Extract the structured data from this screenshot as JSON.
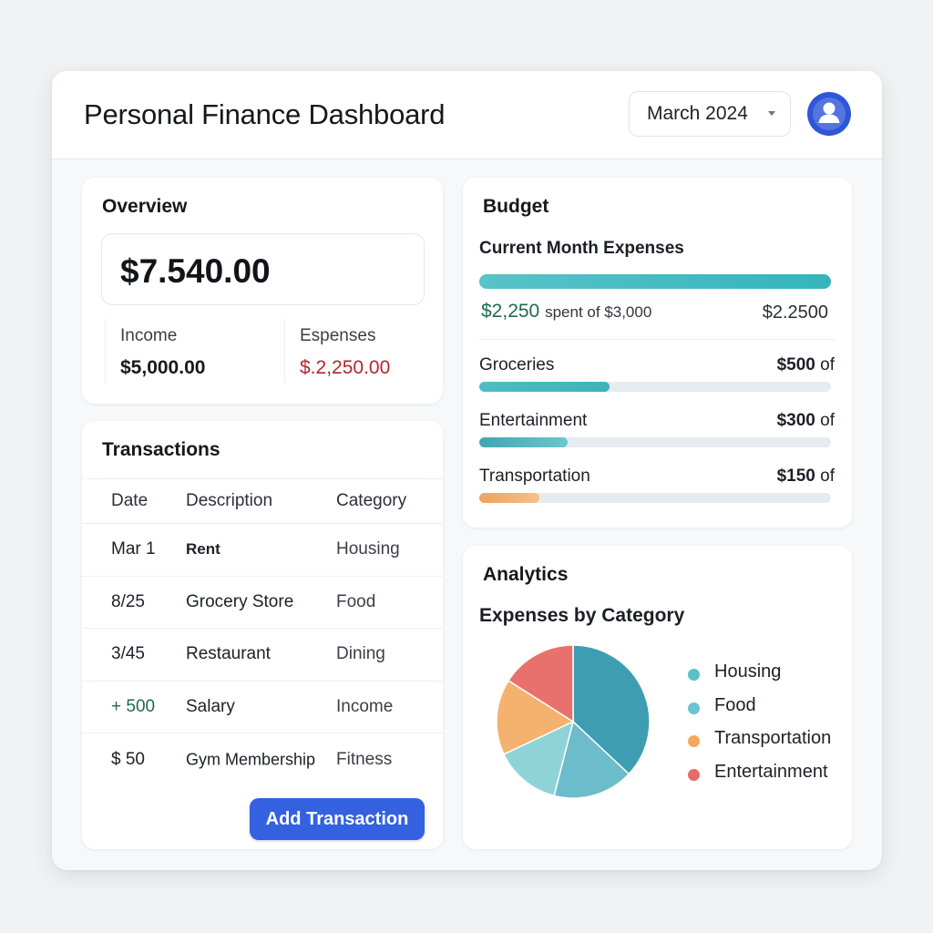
{
  "header": {
    "title": "Personal Finance Dashboard",
    "month_selector": "March 2024",
    "avatar_icon": "user-icon"
  },
  "overview": {
    "title": "Overview",
    "balance": "$7.540.00",
    "income_label": "Income",
    "income_value": "$5,000.00",
    "expenses_label": "Espenses",
    "expenses_value": "$.2,250.00",
    "expenses_color": "#b3262d"
  },
  "transactions": {
    "title": "Transactions",
    "columns": [
      "Date",
      "Description",
      "Category"
    ],
    "rows": [
      {
        "date": "Mar 1",
        "description": "Rent",
        "category": "Housing"
      },
      {
        "date": "8/25",
        "description": "Grocery Store",
        "category": "Food"
      },
      {
        "date": "3/45",
        "description": "Restaurant",
        "category": "Dining"
      },
      {
        "date": "+ 500",
        "description": "Salary",
        "category": "Income"
      },
      {
        "date": "$ 50",
        "description": "Gym Membership",
        "category": "Fitness"
      }
    ],
    "add_button": "Add Transaction",
    "button_color": "#3461e0"
  },
  "budget": {
    "title": "Budget",
    "subtitle": "Current Month Expenses",
    "main_progress": 1.0,
    "spent_amount": "$2,250",
    "spent_text": "spent of $3,000",
    "spent_right": "$2.2500",
    "categories": [
      {
        "name": "Groceries",
        "amount": "$500",
        "suffix": "of",
        "progress": 0.37
      },
      {
        "name": "Entertainment",
        "amount": "$300",
        "suffix": "of",
        "progress": 0.25
      },
      {
        "name": "Transportation",
        "amount": "$150",
        "suffix": "of",
        "progress": 0.17
      }
    ]
  },
  "analytics": {
    "title": "Analytics",
    "subtitle": "Expenses by Category",
    "legend": [
      {
        "label": "Housing",
        "color": "#5bbfc9"
      },
      {
        "label": "Food",
        "color": "#6cc3d0"
      },
      {
        "label": "Transportation",
        "color": "#f4a85d"
      },
      {
        "label": "Entertainment",
        "color": "#e66a6a"
      }
    ]
  },
  "chart_data": {
    "type": "pie",
    "title": "Expenses by Category",
    "categories": [
      "Housing",
      "Food",
      "Food (light)",
      "Transportation",
      "Entertainment"
    ],
    "values": [
      37,
      17,
      14,
      16,
      16
    ],
    "colors": [
      "#3f9db3",
      "#6cbccb",
      "#8fd3d8",
      "#f4b26e",
      "#e8716e"
    ]
  }
}
